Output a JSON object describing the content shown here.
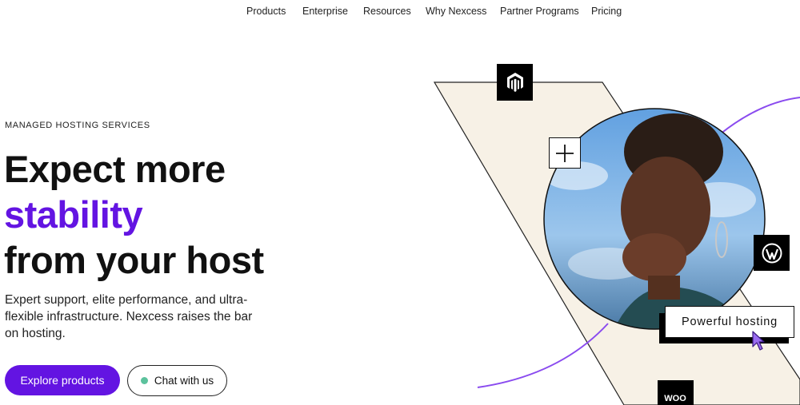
{
  "nav": {
    "items": [
      {
        "label": "Products"
      },
      {
        "label": "Enterprise"
      },
      {
        "label": "Resources"
      },
      {
        "label": "Why Nexcess"
      },
      {
        "label": "Partner Programs"
      },
      {
        "label": "Pricing"
      }
    ]
  },
  "hero": {
    "eyebrow": "MANAGED HOSTING SERVICES",
    "headline": {
      "line1": "Expect more",
      "accent": "stability",
      "line3": "from your host"
    },
    "subtext": "Expert support, elite performance, and ultra-flexible infrastructure. Nexcess raises the bar on hosting.",
    "primary_cta": "Explore products",
    "secondary_cta": "Chat with us"
  },
  "graphic": {
    "callout": "Powerful hosting",
    "logos": [
      "magento-icon",
      "wordpress-icon",
      "woocommerce-icon"
    ],
    "woo_label": "WOO",
    "icons": [
      "plus-icon",
      "cursor-icon",
      "status-dot"
    ]
  },
  "colors": {
    "accent": "#6314e2",
    "panel": "#f7f1e6",
    "sky": "#6fa8dc",
    "status": "#5cc29d",
    "text": "#111111"
  }
}
